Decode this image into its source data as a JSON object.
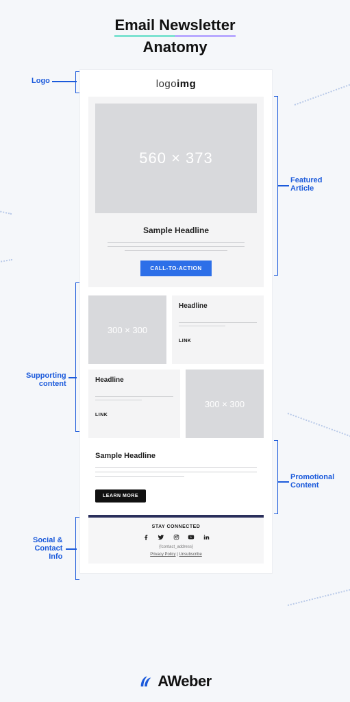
{
  "title": {
    "line1": "Email Newsletter",
    "line2": "Anatomy"
  },
  "annotations": {
    "logo": "Logo",
    "featured": "Featured\nArticle",
    "supporting": "Supporting\ncontent",
    "promotional": "Promotional\nContent",
    "social": "Social &\nContact\nInfo"
  },
  "email": {
    "logo_light": "logo",
    "logo_bold": "img",
    "hero_dimensions": "560 × 373",
    "featured_headline": "Sample Headline",
    "cta_label": "CALL-TO-ACTION",
    "supporting": [
      {
        "img": "300 × 300",
        "headline": "Headline",
        "link": "LINK"
      },
      {
        "img": "300 × 300",
        "headline": "Headline",
        "link": "LINK"
      }
    ],
    "promo_headline": "Sample Headline",
    "learn_label": "LEARN MORE",
    "footer": {
      "stay": "STAY CONNECTED",
      "address": "{!contact_address}",
      "privacy": "Privacy Policy",
      "sep": " | ",
      "unsubscribe": "Unsubscribe"
    }
  },
  "brand": "AWeber"
}
